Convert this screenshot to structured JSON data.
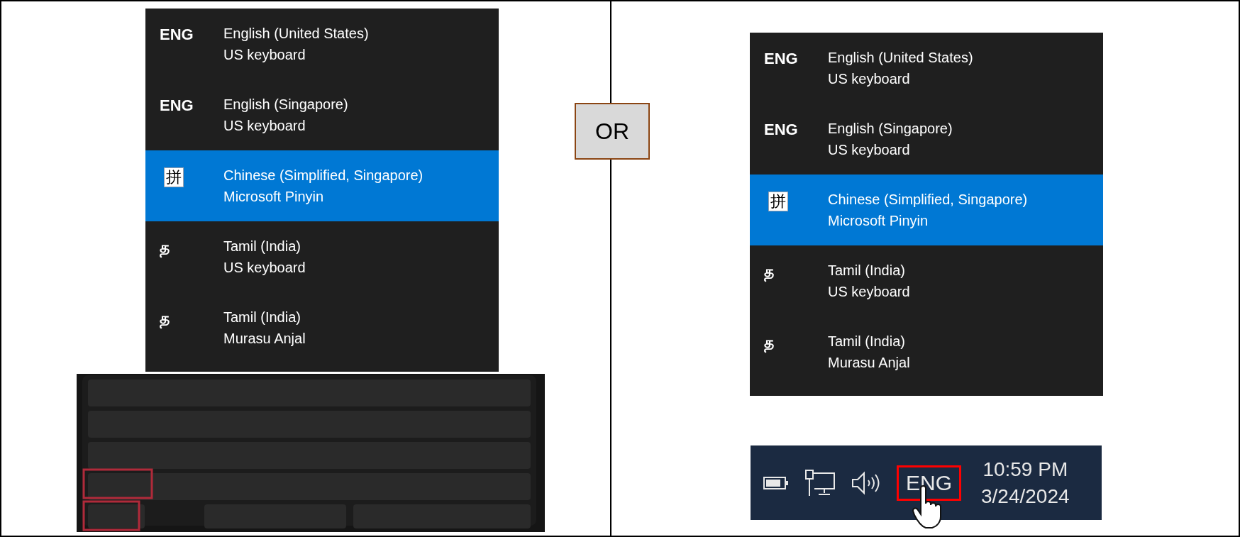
{
  "left_panel": {
    "language_menu": {
      "items": [
        {
          "kind": "text",
          "icon": "ENG",
          "language": "English (United States)",
          "keyboard": "US keyboard",
          "selected": false
        },
        {
          "kind": "text",
          "icon": "ENG",
          "language": "English (Singapore)",
          "keyboard": "US keyboard",
          "selected": false
        },
        {
          "kind": "boxed",
          "icon": "拼",
          "language": "Chinese (Simplified, Singapore)",
          "keyboard": "Microsoft Pinyin",
          "selected": true
        },
        {
          "kind": "text",
          "icon": "த",
          "language": "Tamil (India)",
          "keyboard": "US keyboard",
          "selected": false
        },
        {
          "kind": "text",
          "icon": "த",
          "language": "Tamil (India)",
          "keyboard": "Murasu Anjal",
          "selected": false
        }
      ]
    }
  },
  "or_label": "OR",
  "right_panel": {
    "language_menu": {
      "items": [
        {
          "kind": "text",
          "icon": "ENG",
          "language": "English (United States)",
          "keyboard": "US keyboard",
          "selected": false
        },
        {
          "kind": "text",
          "icon": "ENG",
          "language": "English (Singapore)",
          "keyboard": "US keyboard",
          "selected": false
        },
        {
          "kind": "boxed",
          "icon": "拼",
          "language": "Chinese (Simplified, Singapore)",
          "keyboard": "Microsoft Pinyin",
          "selected": true
        },
        {
          "kind": "text",
          "icon": "த",
          "language": "Tamil (India)",
          "keyboard": "US keyboard",
          "selected": false
        },
        {
          "kind": "text",
          "icon": "த",
          "language": "Tamil (India)",
          "keyboard": "Murasu Anjal",
          "selected": false
        }
      ]
    },
    "taskbar": {
      "language": "ENG",
      "language_highlighted": true,
      "time": "10:59 PM",
      "date": "3/24/2024"
    }
  }
}
